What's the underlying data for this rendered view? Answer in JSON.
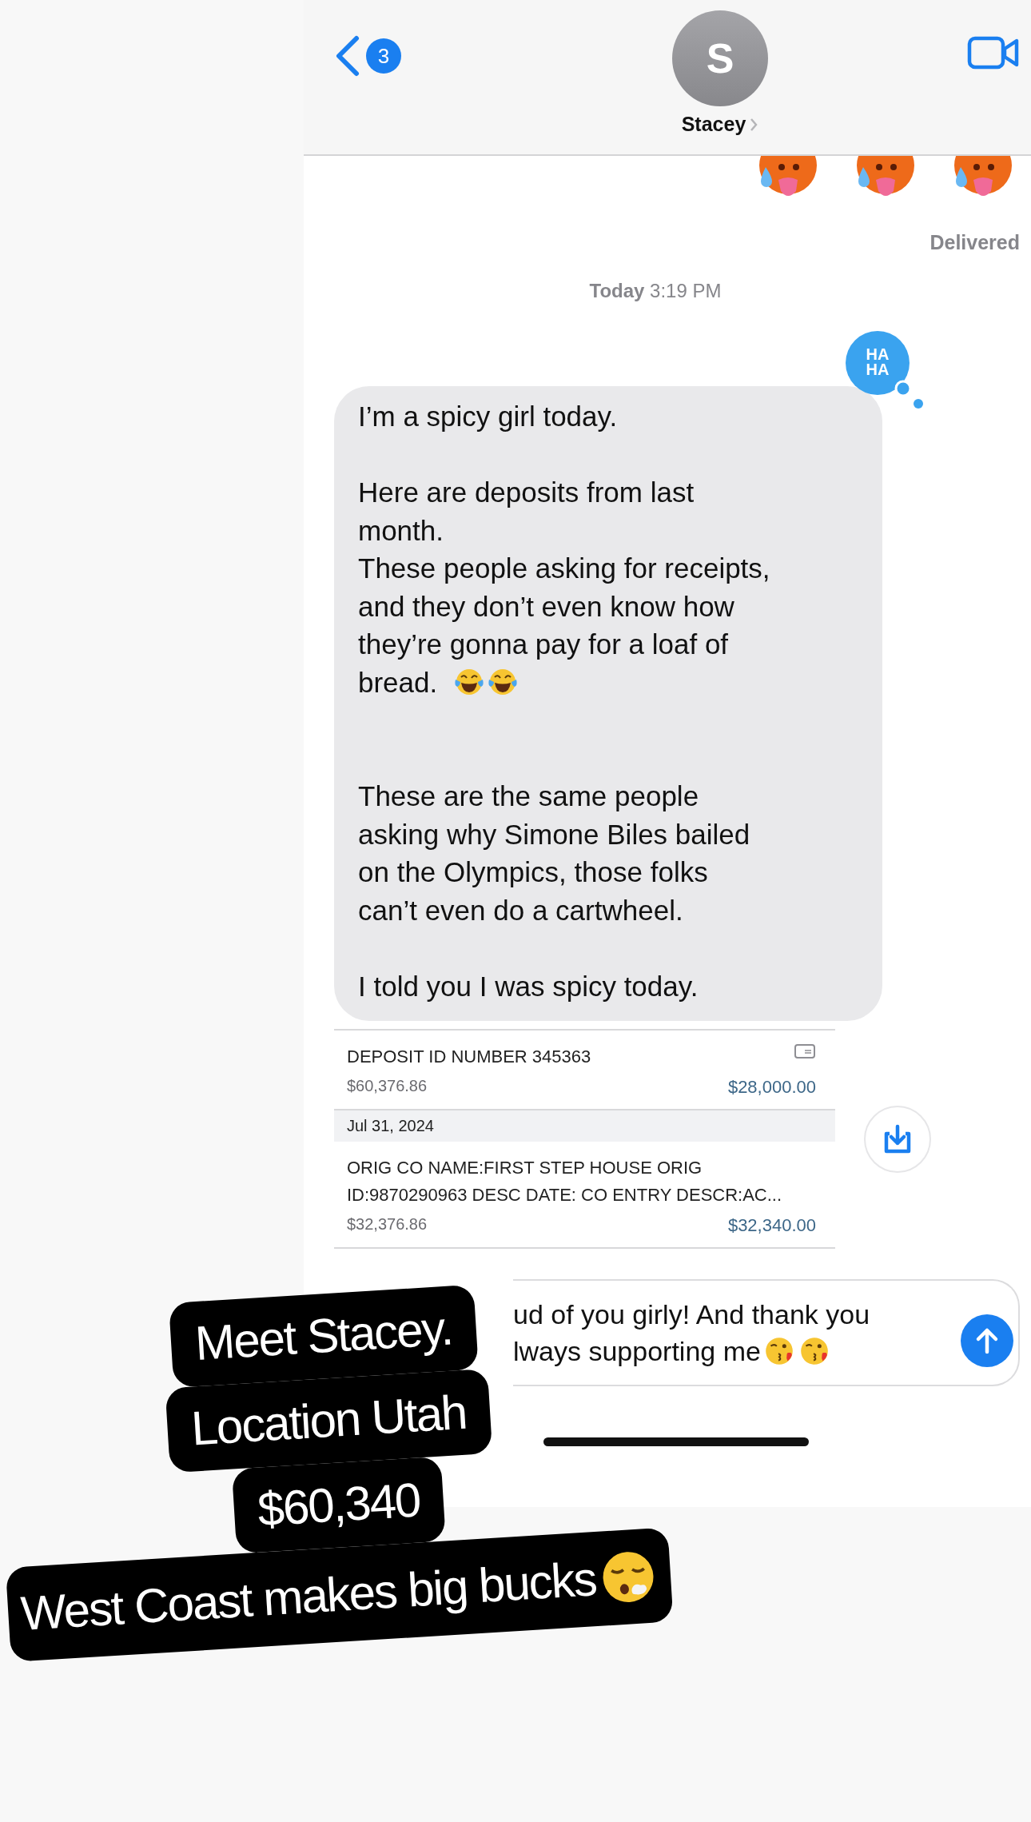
{
  "header": {
    "back_badge": "3",
    "avatar_initial": "S",
    "contact_name": "Stacey"
  },
  "delivered_status": "Delivered",
  "timestamp": "**Today** 3:19 PM",
  "tapback": {
    "lines": [
      "HA",
      "HA"
    ]
  },
  "bubble": {
    "blocks": [
      {
        "kind": "text",
        "text": "I’m a spicy girl today.\n\nHere are deposits from last\nmonth.\nThese people asking for receipts,\nand they don’t even know how\nthey’re gonna pay for a loaf of"
      },
      {
        "kind": "text_with_laughing_emoji",
        "text": "bread."
      },
      {
        "kind": "text",
        "text": "\n\nThese are the same people\nasking why Simone Biles bailed\non the Olympics, those folks\ncan’t even do a cartwheel.\n\nI told you I was spicy today."
      }
    ]
  },
  "statement": {
    "items": [
      {
        "kind": "transaction",
        "description": "DEPOSIT ID NUMBER 345363",
        "balance": "$60,376.86",
        "amount": "$28,000.00",
        "check_icon": true
      },
      {
        "kind": "date",
        "label": "Jul 31, 2024"
      },
      {
        "kind": "transaction",
        "description": "ORIG CO NAME:FIRST STEP HOUSE ORIG\nID:9870290963 DESC DATE: CO ENTRY DESCR:AC...",
        "balance": "$32,376.86",
        "amount": "$32,340.00",
        "check_icon": false
      }
    ]
  },
  "composer": {
    "lines": [
      "ud of you girly! And thank you",
      "lways supporting me"
    ]
  },
  "captions": [
    {
      "kind": "plain",
      "text": "Meet Stacey."
    },
    {
      "kind": "plain",
      "text": "Location Utah"
    },
    {
      "kind": "plain",
      "text": "$60,340"
    },
    {
      "kind": "with_exhale_emoji",
      "text": "West Coast makes big bucks"
    }
  ]
}
